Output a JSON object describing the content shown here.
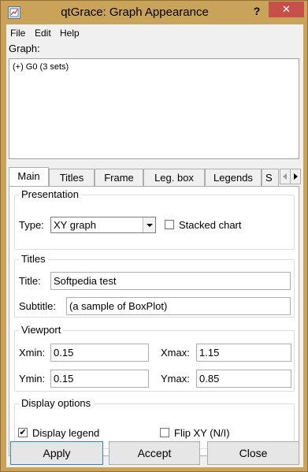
{
  "window": {
    "title": "qtGrace: Graph Appearance",
    "help_glyph": "?",
    "close_glyph": "✕"
  },
  "menu": {
    "items": [
      "File",
      "Edit",
      "Help"
    ]
  },
  "graph": {
    "label": "Graph:",
    "rows": [
      "(+) G0 (3 sets)"
    ]
  },
  "tabs": {
    "items": [
      "Main",
      "Titles",
      "Frame",
      "Leg. box",
      "Legends",
      "S"
    ],
    "active": "Main",
    "scroll_right_glyph": "▶"
  },
  "presentation": {
    "title": "Presentation",
    "type_label": "Type:",
    "type_value": "XY graph",
    "stacked_label": "Stacked chart",
    "stacked_checked": false
  },
  "titles": {
    "title": "Titles",
    "title_label": "Title:",
    "title_value": "Softpedia test",
    "subtitle_label": "Subtitle:",
    "subtitle_value": "(a sample of BoxPlot)"
  },
  "viewport": {
    "title": "Viewport",
    "xmin_label": "Xmin:",
    "xmin_value": "0.15",
    "xmax_label": "Xmax:",
    "xmax_value": "1.15",
    "ymin_label": "Ymin:",
    "ymin_value": "0.15",
    "ymax_label": "Ymax:",
    "ymax_value": "0.85"
  },
  "display": {
    "title": "Display options",
    "legend_label": "Display legend",
    "legend_checked": true,
    "legend_mark": "✔",
    "flip_label": "Flip XY (N/I)",
    "flip_checked": false
  },
  "buttons": {
    "apply": "Apply",
    "accept": "Accept",
    "close": "Close"
  },
  "colors": {
    "title_bar": "#c9a35a",
    "close_button": "#c7504b",
    "dialog_background": "#f0f0f0"
  }
}
